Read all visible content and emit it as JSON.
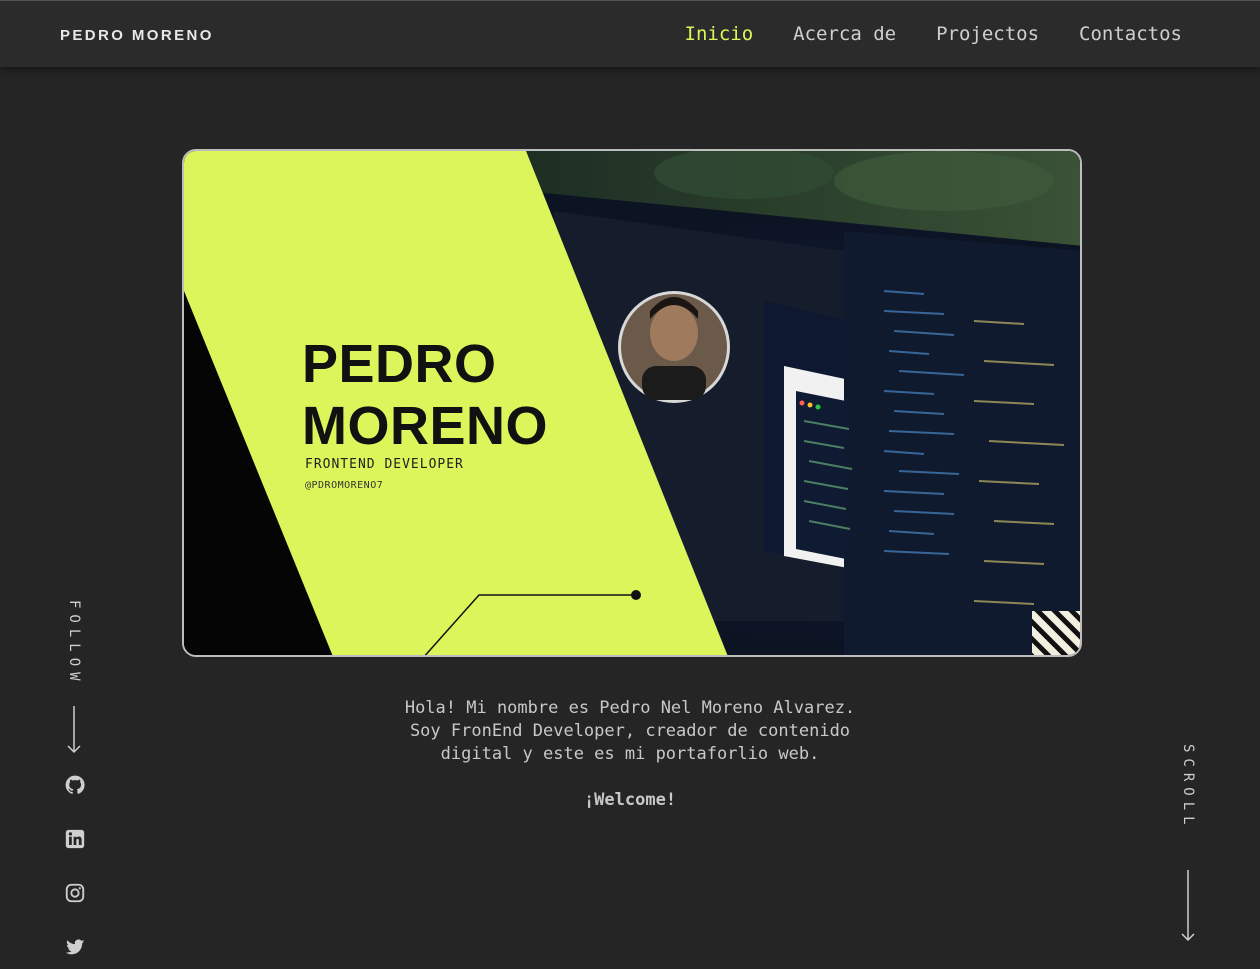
{
  "header": {
    "brand": "PEDRO MORENO",
    "nav": [
      "Inicio",
      "Acerca de",
      "Projectos",
      "Contactos"
    ],
    "active_index": 0
  },
  "hero": {
    "name_line1": "PEDRO",
    "name_line2": "MORENO",
    "role": "FRONTEND DEVELOPER",
    "handle": "@PDROMORENO7",
    "accent": "#dcf55a"
  },
  "intro": {
    "lines": [
      "Hola! Mi nombre es Pedro Nel Moreno Alvarez.",
      "Soy FronEnd Developer, creador de contenido",
      "digital y este es mi portaforlio web."
    ],
    "welcome": "¡Welcome!"
  },
  "sidebar_left": {
    "label": "FOLLOW",
    "icons": [
      "github-icon",
      "linkedin-icon",
      "instagram-icon",
      "twitter-icon"
    ]
  },
  "sidebar_right": {
    "label": "SCROLL"
  }
}
